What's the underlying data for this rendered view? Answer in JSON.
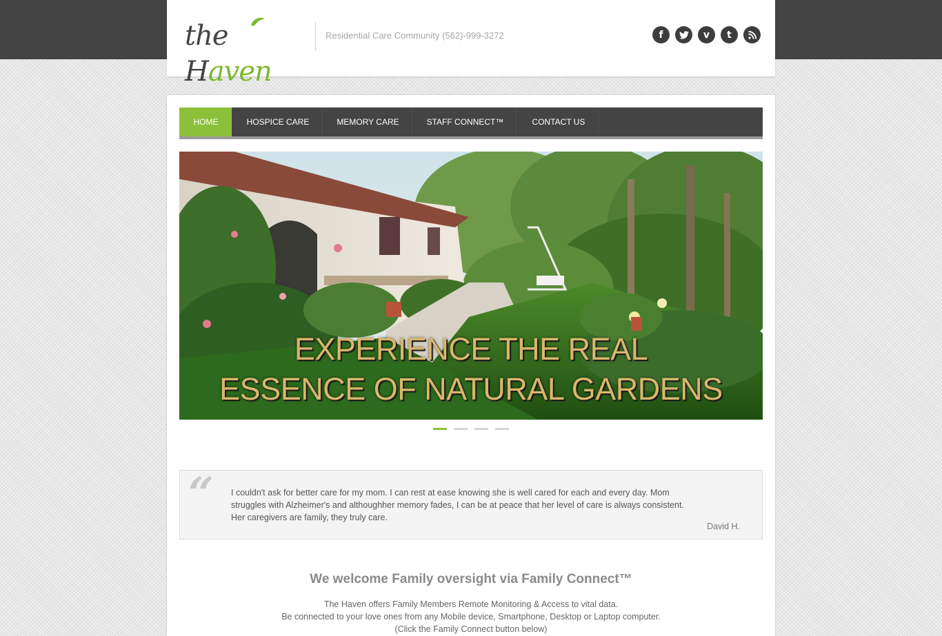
{
  "site": {
    "logo_text_a": "the H",
    "logo_text_b": "aven",
    "tagline": "Residential Care Community (562)-999-3272",
    "brand_color": "#8dc03a",
    "socials": [
      {
        "icon": "facebook-icon",
        "glyph": "f"
      },
      {
        "icon": "twitter-icon",
        "glyph": ""
      },
      {
        "icon": "vimeo-icon",
        "glyph": "v"
      },
      {
        "icon": "tumblr-icon",
        "glyph": "t"
      },
      {
        "icon": "rss-icon",
        "glyph": ""
      }
    ]
  },
  "nav": {
    "items": [
      "HOME",
      "HOSPICE CARE",
      "MEMORY CARE",
      "STAFF CONNECT™",
      "CONTACT US"
    ],
    "active_index": 0
  },
  "slider": {
    "caption_line1": "EXPERIENCE THE REAL",
    "caption_line2": "ESSENCE OF NATURAL GARDENS",
    "slide_count": 4,
    "active_slide": 1
  },
  "testimonial": {
    "quote": "I couldn't ask for better care for my mom. I can rest at ease knowing she is well cared for each and every day. Mom struggles with Alzheimer's and althoughher memory fades, I can be at peace that her level of care is always consistent. Her caregivers are family, they truly care.",
    "author": "David H."
  },
  "welcome": {
    "title": "We welcome Family oversight via Family Connect™",
    "line1": "The Haven offers Family Members Remote Monitoring & Access to vital data.",
    "line2": "Be connected to your love ones from any Mobile device, Smartphone, Desktop or Laptop computer.",
    "line3": "(Click the Family Connect button below)"
  }
}
